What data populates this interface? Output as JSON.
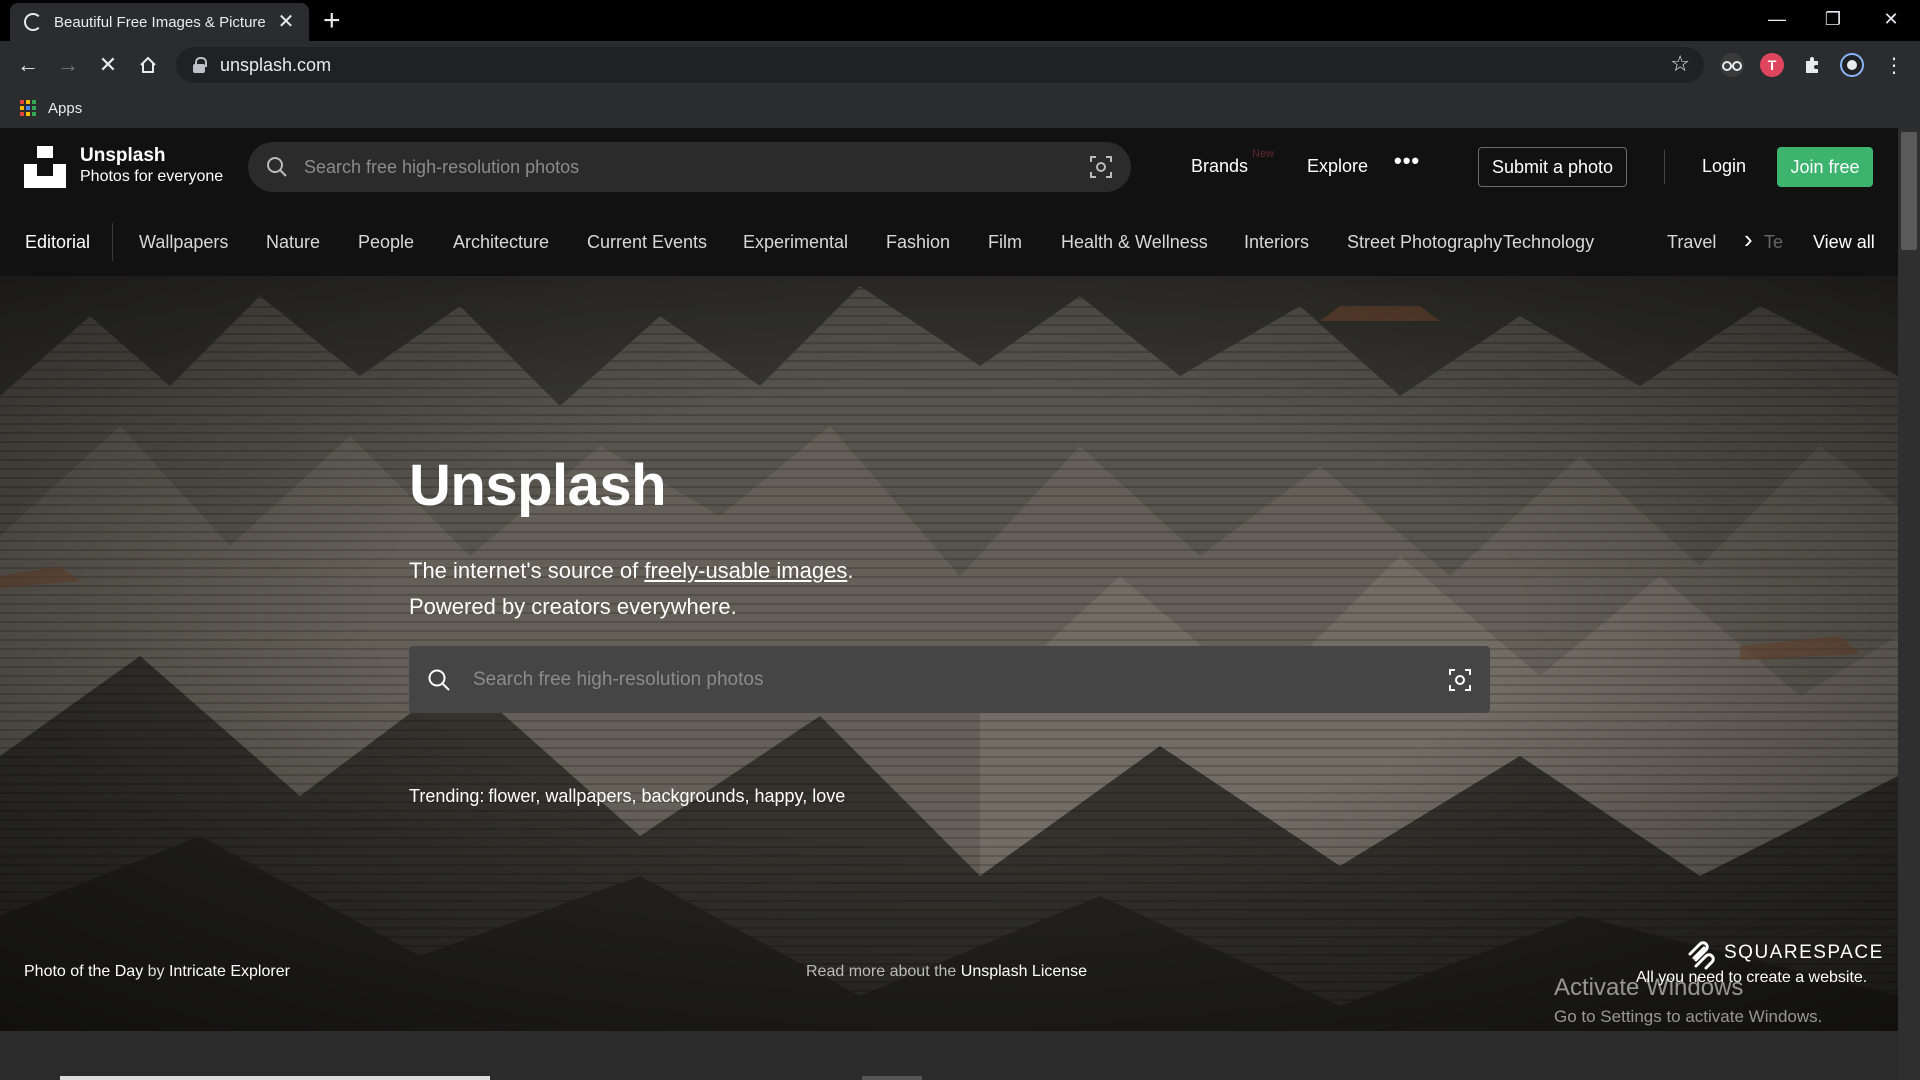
{
  "browser": {
    "tab_title": "Beautiful Free Images & Pictures",
    "url": "unsplash.com",
    "bookmarks_apps": "Apps",
    "ext_t_label": "T"
  },
  "header": {
    "brand_name": "Unsplash",
    "brand_tagline": "Photos for everyone",
    "search_placeholder": "Search free high-resolution photos",
    "brands": "Brands",
    "new_badge": "New",
    "explore": "Explore",
    "submit": "Submit a photo",
    "login": "Login",
    "join": "Join free"
  },
  "categories": {
    "items": [
      "Editorial",
      "Wallpapers",
      "Nature",
      "People",
      "Architecture",
      "Current Events",
      "Experimental",
      "Fashion",
      "Film",
      "Health & Wellness",
      "Interiors",
      "Street Photography",
      "Technology",
      "Travel"
    ],
    "faded": "Te",
    "view_all": "View all"
  },
  "hero": {
    "title": "Unsplash",
    "sub_line1_prefix": "The internet's source of ",
    "sub_link": "freely-usable images",
    "sub_line1_suffix": ".",
    "sub_line2": "Powered by creators everywhere.",
    "search_placeholder": "Search free high-resolution photos",
    "trending_label": "Trending:",
    "trending_terms": "flower, wallpapers, backgrounds, happy, love",
    "potd_prefix": "Photo of the Day",
    "potd_by": " by ",
    "potd_author": "Intricate Explorer",
    "license_prefix": "Read more about the ",
    "license_link": "Unsplash License",
    "sponsor_name": "SQUARESPACE",
    "sponsor_tagline": "All you need to create a website."
  },
  "windows_overlay": {
    "line1": "Activate Windows",
    "line2": "Go to Settings to activate Windows."
  },
  "colors": {
    "header_bg": "#111111",
    "join_green": "#3cb46e",
    "hero_search_bg": "#454545"
  }
}
